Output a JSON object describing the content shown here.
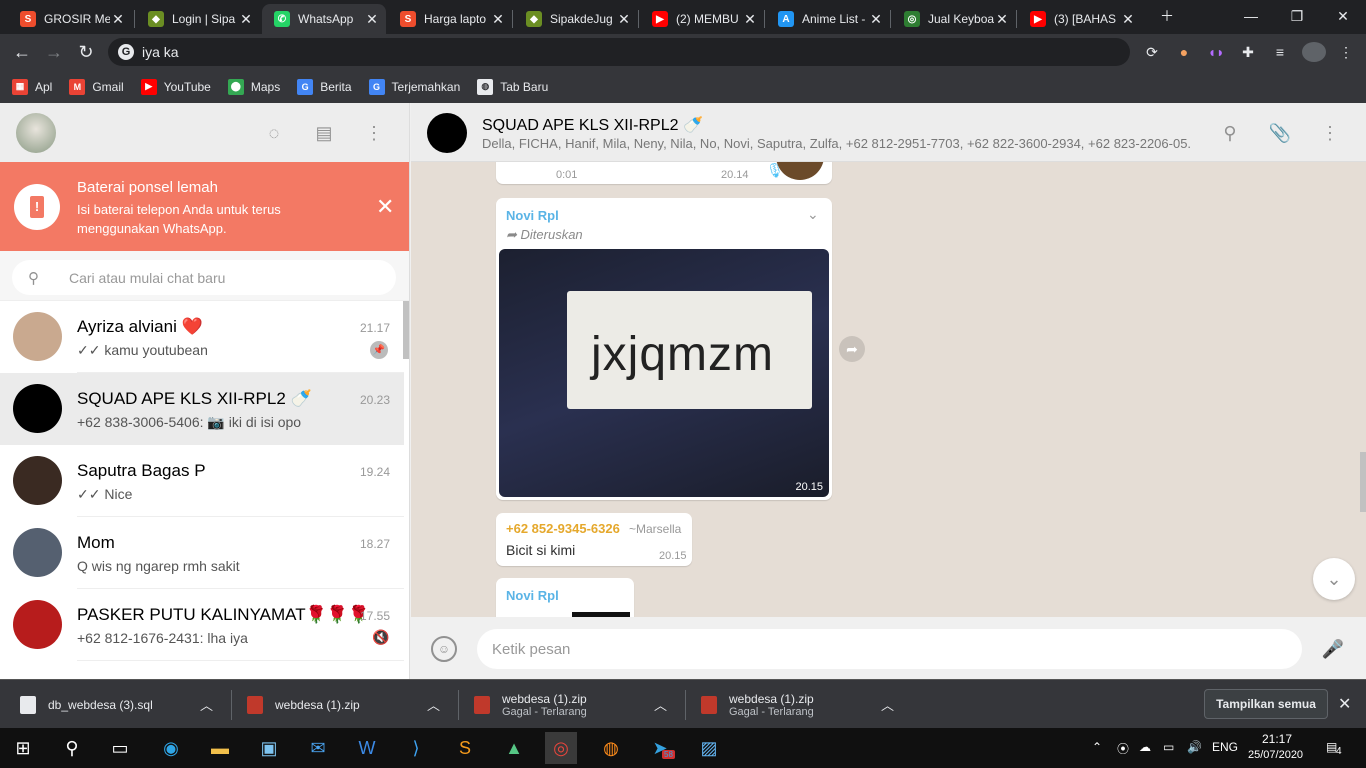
{
  "browser": {
    "tabs": [
      {
        "title": "GROSIR Me",
        "favicon_color": "#ee4d2d",
        "favicon": "S"
      },
      {
        "title": "Login | Sipa",
        "favicon_color": "#6b8e23",
        "favicon": "◆"
      },
      {
        "title": "WhatsApp",
        "favicon_color": "#25d366",
        "favicon": "✆"
      },
      {
        "title": "Harga lapto",
        "favicon_color": "#ee4d2d",
        "favicon": "S"
      },
      {
        "title": "SipakdeJug",
        "favicon_color": "#6b8e23",
        "favicon": "◆"
      },
      {
        "title": "(2) MEMBU",
        "favicon_color": "#ff0000",
        "favicon": "▶"
      },
      {
        "title": "Anime List -",
        "favicon_color": "#2196f3",
        "favicon": "A"
      },
      {
        "title": "Jual Keyboa",
        "favicon_color": "#2e7d32",
        "favicon": "◎"
      },
      {
        "title": "(3) [BAHAS",
        "favicon_color": "#ff0000",
        "favicon": "▶"
      }
    ],
    "active_tab": 2,
    "address": "iya ka",
    "bookmarks": [
      {
        "label": "Apl",
        "color": "#ea4335",
        "glyph": "▦"
      },
      {
        "label": "Gmail",
        "color": "#ea4335",
        "glyph": "M"
      },
      {
        "label": "YouTube",
        "color": "#ff0000",
        "glyph": "▶"
      },
      {
        "label": "Maps",
        "color": "#34a853",
        "glyph": "⬤"
      },
      {
        "label": "Berita",
        "color": "#4285f4",
        "glyph": "G"
      },
      {
        "label": "Terjemahkan",
        "color": "#4285f4",
        "glyph": "G"
      },
      {
        "label": "Tab Baru",
        "color": "#e8eaed",
        "glyph": "◍"
      }
    ]
  },
  "whatsapp": {
    "battery_alert": {
      "title": "Baterai ponsel lemah",
      "body": "Isi baterai telepon Anda untuk terus menggunakan WhatsApp."
    },
    "search_placeholder": "Cari atau mulai chat baru",
    "chats": [
      {
        "name": "Ayriza alviani ❤️",
        "preview": "✓✓ kamu youtubean",
        "time": "21.17",
        "pinned": true,
        "avatar_color": "#c9a98f"
      },
      {
        "name": "SQUAD  APE KLS XII-RPL2 🍼",
        "preview": "+62 838-3006-5406: 📷 iki di isi opo",
        "time": "20.23",
        "selected": true,
        "avatar_color": "#000000"
      },
      {
        "name": "Saputra Bagas P",
        "preview": "✓✓ Nice",
        "time": "19.24",
        "avatar_color": "#3a2a22"
      },
      {
        "name": "Mom",
        "preview": "Q wis ng ngarep rmh sakit",
        "time": "18.27",
        "avatar_color": "#556070"
      },
      {
        "name": "PASKER PUTU KALINYAMAT🌹🌹🌹",
        "preview": "+62 812-1676-2431: lha iya",
        "time": "17.55",
        "muted": true,
        "avatar_color": "#b71c1c"
      }
    ],
    "conversation": {
      "title": "SQUAD  APE KLS XII-RPL2 🍼",
      "members": "Della, FICHA, Hanif, Mila, Neny, Nila, No, Novi, Saputra, Zulfa, +62 812-2951-7703, +62 822-3600-2934, +62 823-2206-05...",
      "prev_audio": {
        "duration": "0:01",
        "time": "20.14"
      },
      "messages": [
        {
          "sender": "Novi Rpl",
          "forwarded": "Diteruskan",
          "image_text": "jxjqmzm",
          "time": "20.15"
        },
        {
          "sender": "+62 852-9345-6326",
          "push_name": "~Marsella",
          "text": "Bicit si kimi",
          "time": "20.15"
        },
        {
          "sender": "Novi Rpl"
        }
      ],
      "composer_placeholder": "Ketik pesan"
    }
  },
  "downloads": {
    "items": [
      {
        "name": "db_webdesa (3).sql",
        "status": ""
      },
      {
        "name": "webdesa (1).zip",
        "status": ""
      },
      {
        "name": "webdesa (1).zip",
        "status": "Gagal - Terlarang"
      },
      {
        "name": "webdesa (1).zip",
        "status": "Gagal - Terlarang"
      }
    ],
    "show_all": "Tampilkan semua"
  },
  "taskbar": {
    "lang": "ENG",
    "time": "21:17",
    "date": "25/07/2020",
    "notifications": "4",
    "telegram_badge": "58"
  }
}
